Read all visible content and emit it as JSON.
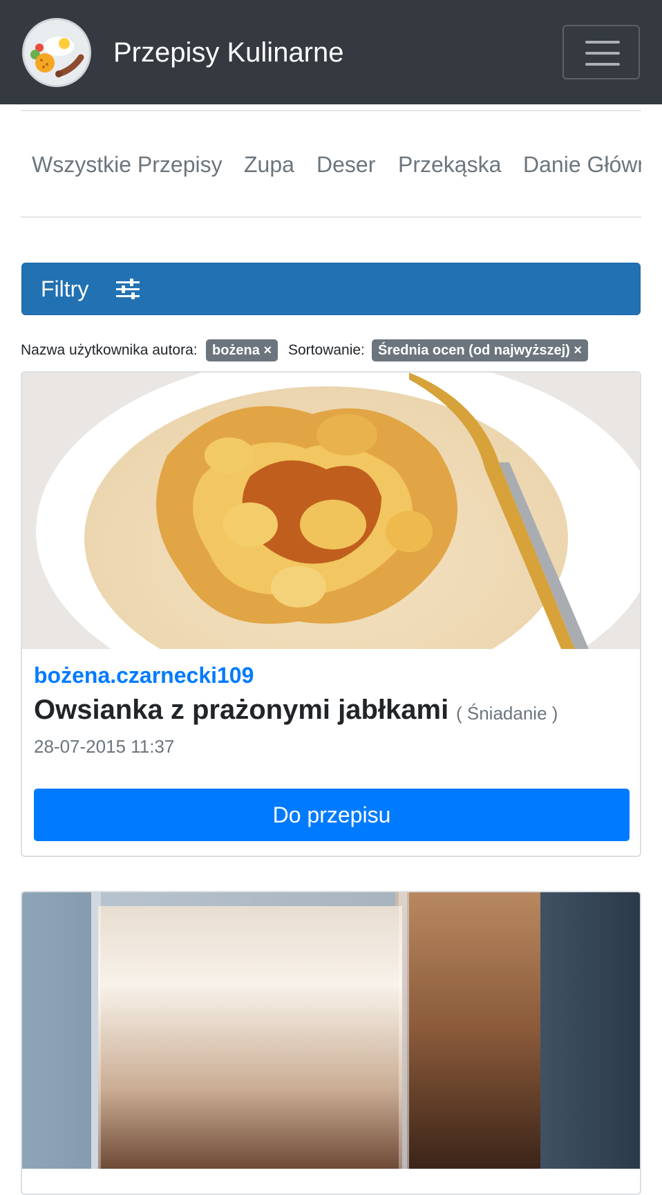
{
  "header": {
    "brand_title": "Przepisy Kulinarne",
    "logo_icon": "breakfast-plate-icon",
    "menu_icon": "hamburger-menu-icon",
    "bg_color": "#343a40"
  },
  "categories": [
    "Wszystkie Przepisy",
    "Zupa",
    "Deser",
    "Przekąska",
    "Danie Główne"
  ],
  "filters": {
    "button_label": "Filtry",
    "button_icon": "sliders-icon",
    "button_color": "#2271b3",
    "author_label": "Nazwa użytkownika autora:",
    "author_badge": "bożena ×",
    "sort_label": "Sortowanie:",
    "sort_badge": "Średnia ocen (od najwyższej) ×"
  },
  "recipes": [
    {
      "author": "bożena.czarnecki109",
      "title": "Owsianka z prażonymi jabłkami",
      "category": "( Śniadanie )",
      "date": "28-07-2015 11:37",
      "button": "Do przepisu",
      "image": "oatmeal-with-apples-photo"
    },
    {
      "image": "coffee-latte-photo"
    }
  ],
  "colors": {
    "accent": "#007bff",
    "muted": "#6c757d"
  }
}
